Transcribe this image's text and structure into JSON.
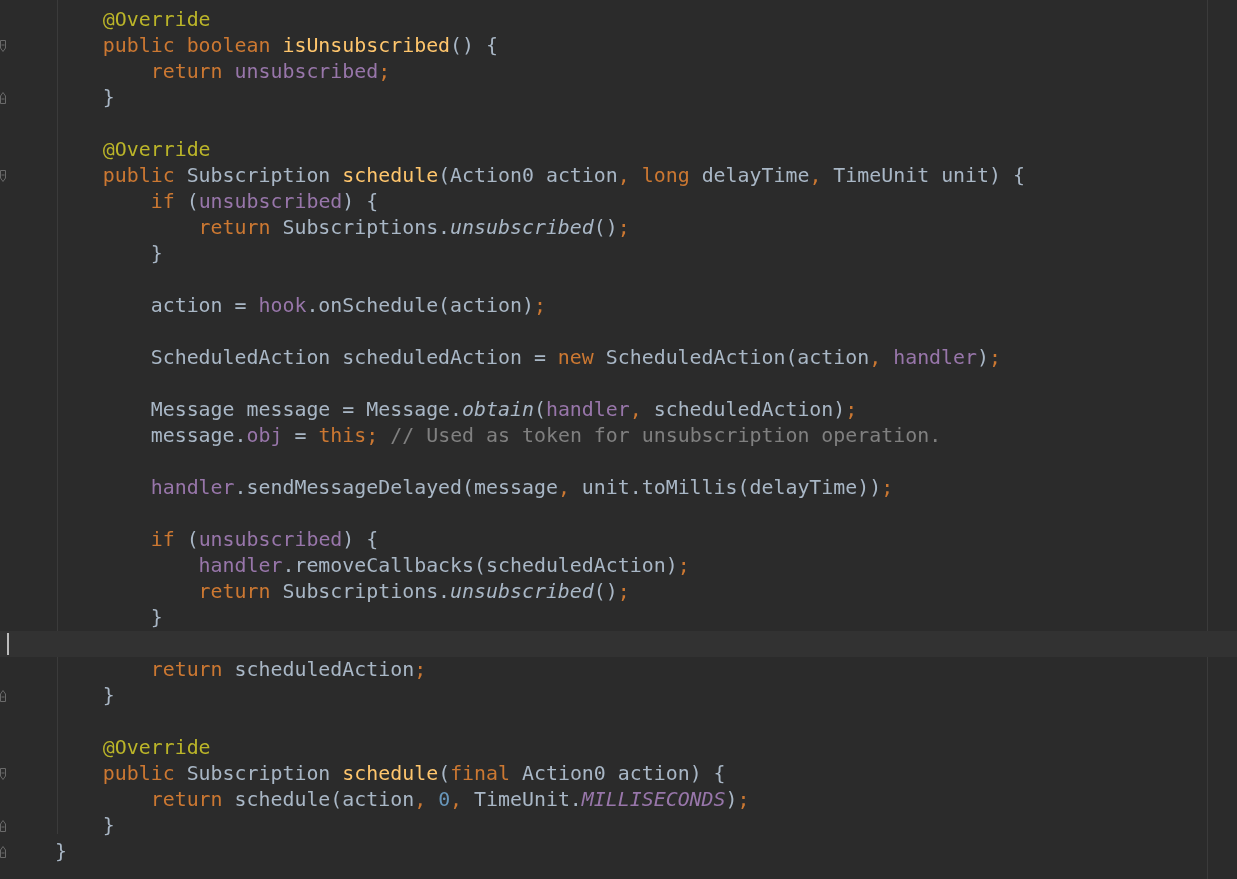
{
  "editor": {
    "lines": [
      {
        "kind": "plain",
        "tokens": [
          {
            "text": "        @Override",
            "kind": "annotation"
          }
        ]
      },
      {
        "kind": "opener",
        "tokens": [
          {
            "text": "        public boolean ",
            "kind": "keyword"
          },
          {
            "text": "isUnsubscribed",
            "kind": "method"
          },
          {
            "text": "() {",
            "kind": "plain"
          }
        ]
      },
      {
        "kind": "plain",
        "tokens": [
          {
            "text": "            return ",
            "kind": "keyword"
          },
          {
            "text": "unsubscribed",
            "kind": "field"
          },
          {
            "text": ";",
            "kind": "punct"
          }
        ]
      },
      {
        "kind": "closer",
        "tokens": [
          {
            "text": "        }",
            "kind": "plain"
          }
        ]
      },
      {
        "kind": "plain"
      },
      {
        "kind": "plain",
        "tokens": [
          {
            "text": "        @Override",
            "kind": "annotation"
          }
        ]
      },
      {
        "kind": "opener",
        "tokens": [
          {
            "text": "        public ",
            "kind": "keyword"
          },
          {
            "text": "Subscription ",
            "kind": "plain"
          },
          {
            "text": "schedule",
            "kind": "method"
          },
          {
            "text": "(Action0 action",
            "kind": "plain"
          },
          {
            "text": ", ",
            "kind": "punct"
          },
          {
            "text": "long ",
            "kind": "keyword"
          },
          {
            "text": "delayTime",
            "kind": "plain"
          },
          {
            "text": ", ",
            "kind": "punct"
          },
          {
            "text": "TimeUnit unit) {",
            "kind": "plain"
          }
        ]
      },
      {
        "kind": "plain",
        "tokens": [
          {
            "text": "            if ",
            "kind": "keyword"
          },
          {
            "text": "(",
            "kind": "plain"
          },
          {
            "text": "unsubscribed",
            "kind": "field"
          },
          {
            "text": ") {",
            "kind": "plain"
          }
        ]
      },
      {
        "kind": "plain",
        "tokens": [
          {
            "text": "                return ",
            "kind": "keyword"
          },
          {
            "text": "Subscriptions.",
            "kind": "plain"
          },
          {
            "text": "unsubscribed",
            "kind": "italic"
          },
          {
            "text": "()",
            "kind": "plain"
          },
          {
            "text": ";",
            "kind": "punct"
          }
        ]
      },
      {
        "kind": "plain",
        "tokens": [
          {
            "text": "            }",
            "kind": "plain"
          }
        ]
      },
      {
        "kind": "plain"
      },
      {
        "kind": "plain",
        "tokens": [
          {
            "text": "            action = ",
            "kind": "plain"
          },
          {
            "text": "hook",
            "kind": "field"
          },
          {
            "text": ".onSchedule(action)",
            "kind": "plain"
          },
          {
            "text": ";",
            "kind": "punct"
          }
        ]
      },
      {
        "kind": "plain"
      },
      {
        "kind": "plain",
        "tokens": [
          {
            "text": "            ScheduledAction scheduledAction = ",
            "kind": "plain"
          },
          {
            "text": "new ",
            "kind": "keyword"
          },
          {
            "text": "ScheduledAction(action",
            "kind": "plain"
          },
          {
            "text": ", ",
            "kind": "punct"
          },
          {
            "text": "handler",
            "kind": "field"
          },
          {
            "text": ")",
            "kind": "plain"
          },
          {
            "text": ";",
            "kind": "punct"
          }
        ]
      },
      {
        "kind": "plain"
      },
      {
        "kind": "plain",
        "tokens": [
          {
            "text": "            Message message = Message.",
            "kind": "plain"
          },
          {
            "text": "obtain",
            "kind": "italic"
          },
          {
            "text": "(",
            "kind": "plain"
          },
          {
            "text": "handler",
            "kind": "field"
          },
          {
            "text": ", ",
            "kind": "punct"
          },
          {
            "text": "scheduledAction)",
            "kind": "plain"
          },
          {
            "text": ";",
            "kind": "punct"
          }
        ]
      },
      {
        "kind": "plain",
        "tokens": [
          {
            "text": "            message.",
            "kind": "plain"
          },
          {
            "text": "obj",
            "kind": "field"
          },
          {
            "text": " = ",
            "kind": "plain"
          },
          {
            "text": "this",
            "kind": "keyword"
          },
          {
            "text": "; ",
            "kind": "punct"
          },
          {
            "text": "// Used as token for unsubscription operation.",
            "kind": "comment"
          }
        ]
      },
      {
        "kind": "plain"
      },
      {
        "kind": "plain",
        "tokens": [
          {
            "text": "            handler",
            "kind": "field"
          },
          {
            "text": ".sendMessageDelayed(message",
            "kind": "plain"
          },
          {
            "text": ", ",
            "kind": "punct"
          },
          {
            "text": "unit.toMillis(delayTime))",
            "kind": "plain"
          },
          {
            "text": ";",
            "kind": "punct"
          }
        ]
      },
      {
        "kind": "plain"
      },
      {
        "kind": "plain",
        "tokens": [
          {
            "text": "            if ",
            "kind": "keyword"
          },
          {
            "text": "(",
            "kind": "plain"
          },
          {
            "text": "unsubscribed",
            "kind": "field"
          },
          {
            "text": ") {",
            "kind": "plain"
          }
        ]
      },
      {
        "kind": "plain",
        "tokens": [
          {
            "text": "                handler",
            "kind": "field"
          },
          {
            "text": ".removeCallbacks(scheduledAction)",
            "kind": "plain"
          },
          {
            "text": ";",
            "kind": "punct"
          }
        ]
      },
      {
        "kind": "plain",
        "tokens": [
          {
            "text": "                return ",
            "kind": "keyword"
          },
          {
            "text": "Subscriptions.",
            "kind": "plain"
          },
          {
            "text": "unsubscribed",
            "kind": "italic"
          },
          {
            "text": "()",
            "kind": "plain"
          },
          {
            "text": ";",
            "kind": "punct"
          }
        ]
      },
      {
        "kind": "plain",
        "tokens": [
          {
            "text": "            }",
            "kind": "plain"
          }
        ]
      },
      {
        "kind": "cursor"
      },
      {
        "kind": "plain",
        "tokens": [
          {
            "text": "            return ",
            "kind": "keyword"
          },
          {
            "text": "scheduledAction",
            "kind": "plain"
          },
          {
            "text": ";",
            "kind": "punct"
          }
        ]
      },
      {
        "kind": "closer",
        "tokens": [
          {
            "text": "        }",
            "kind": "plain"
          }
        ]
      },
      {
        "kind": "plain"
      },
      {
        "kind": "plain",
        "tokens": [
          {
            "text": "        @Override",
            "kind": "annotation"
          }
        ]
      },
      {
        "kind": "opener",
        "tokens": [
          {
            "text": "        public ",
            "kind": "keyword"
          },
          {
            "text": "Subscription ",
            "kind": "plain"
          },
          {
            "text": "schedule",
            "kind": "method"
          },
          {
            "text": "(",
            "kind": "plain"
          },
          {
            "text": "final ",
            "kind": "keyword"
          },
          {
            "text": "Action0 action) {",
            "kind": "plain"
          }
        ]
      },
      {
        "kind": "plain",
        "tokens": [
          {
            "text": "            return ",
            "kind": "keyword"
          },
          {
            "text": "schedule(action",
            "kind": "plain"
          },
          {
            "text": ", ",
            "kind": "punct"
          },
          {
            "text": "0",
            "kind": "number"
          },
          {
            "text": ", ",
            "kind": "punct"
          },
          {
            "text": "TimeUnit.",
            "kind": "plain"
          },
          {
            "text": "MILLISECONDS",
            "kind": "static"
          },
          {
            "text": ")",
            "kind": "plain"
          },
          {
            "text": ";",
            "kind": "punct"
          }
        ]
      },
      {
        "kind": "closer",
        "tokens": [
          {
            "text": "        }",
            "kind": "plain"
          }
        ]
      },
      {
        "kind": "closer",
        "tokens": [
          {
            "text": "    }",
            "kind": "plain"
          }
        ]
      }
    ]
  }
}
